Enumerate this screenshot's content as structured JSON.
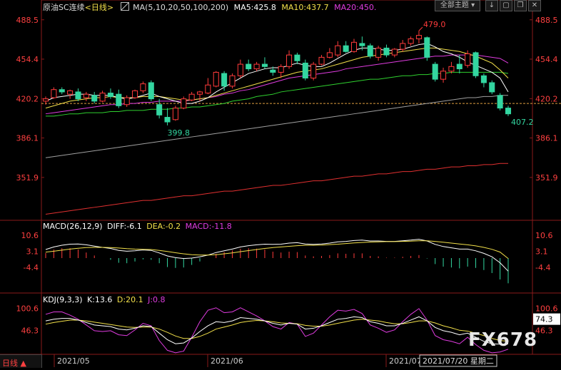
{
  "header": {
    "instrument": "原油SC连续",
    "period": "<日线>",
    "ma_label": "MA(5,10,20,50,100,200)",
    "ma5": "MA5:425.8",
    "ma10": "MA10:437.7",
    "ma20": "MA20:450.",
    "theme_button": "全部主题",
    "icon_names": [
      "chart-type-icon",
      "theme-dropdown-icon",
      "down-arrow-icon",
      "expand-icon",
      "restore-icon",
      "close-icon"
    ]
  },
  "colors": {
    "up": "#ff3b3b",
    "down": "#33d6a0",
    "ma5": "#ffffff",
    "ma10": "#f2e04a",
    "ma20": "#e03ce0",
    "ma50": "#2fd12f",
    "ma100": "#a0a0a0",
    "ma200": "#e03030",
    "price_tick": "#ff4040",
    "macd_title": "#ffffff",
    "dea": "#f2e04a",
    "macd_val": "#e03ce0",
    "k_line": "#ffffff",
    "d_line": "#f2e04a",
    "j_line": "#e03ce0"
  },
  "chart_data": {
    "type": "candlestick",
    "ylim": [
      316,
      497
    ],
    "y_ticks": [
      "488.5",
      "454.4",
      "420.2",
      "386.1",
      "351.9"
    ],
    "x_labels": [
      "2021/05",
      "2021/06",
      "2021/07"
    ],
    "crosshair_label": "2021/07/20 星期二",
    "annotations": {
      "high": "479.0",
      "low_mid": "399.8",
      "last": "407.2"
    },
    "reference_price": 416,
    "candles": [
      {
        "o": 418,
        "h": 422,
        "l": 415,
        "c": 420
      },
      {
        "o": 421,
        "h": 430,
        "l": 420,
        "c": 428
      },
      {
        "o": 428,
        "h": 430,
        "l": 424,
        "c": 426
      },
      {
        "o": 424,
        "h": 428,
        "l": 420,
        "c": 427
      },
      {
        "o": 426,
        "h": 429,
        "l": 418,
        "c": 420
      },
      {
        "o": 421,
        "h": 426,
        "l": 418,
        "c": 424
      },
      {
        "o": 423,
        "h": 426,
        "l": 416,
        "c": 418
      },
      {
        "o": 418,
        "h": 427,
        "l": 417,
        "c": 425
      },
      {
        "o": 425,
        "h": 429,
        "l": 420,
        "c": 422
      },
      {
        "o": 424,
        "h": 428,
        "l": 412,
        "c": 414
      },
      {
        "o": 415,
        "h": 423,
        "l": 413,
        "c": 421
      },
      {
        "o": 421,
        "h": 428,
        "l": 420,
        "c": 427
      },
      {
        "o": 427,
        "h": 435,
        "l": 425,
        "c": 433
      },
      {
        "o": 434,
        "h": 436,
        "l": 418,
        "c": 420
      },
      {
        "o": 415,
        "h": 420,
        "l": 403,
        "c": 406
      },
      {
        "o": 404,
        "h": 412,
        "l": 397,
        "c": 400
      },
      {
        "o": 402,
        "h": 414,
        "l": 401,
        "c": 412
      },
      {
        "o": 412,
        "h": 422,
        "l": 411,
        "c": 420
      },
      {
        "o": 419,
        "h": 426,
        "l": 418,
        "c": 424
      },
      {
        "o": 424,
        "h": 427,
        "l": 418,
        "c": 426
      },
      {
        "o": 425,
        "h": 438,
        "l": 424,
        "c": 432
      },
      {
        "o": 431,
        "h": 444,
        "l": 430,
        "c": 443
      },
      {
        "o": 442,
        "h": 444,
        "l": 427,
        "c": 431
      },
      {
        "o": 431,
        "h": 442,
        "l": 429,
        "c": 440
      },
      {
        "o": 440,
        "h": 454,
        "l": 438,
        "c": 450
      },
      {
        "o": 450,
        "h": 454,
        "l": 444,
        "c": 446
      },
      {
        "o": 446,
        "h": 452,
        "l": 444,
        "c": 450
      },
      {
        "o": 450,
        "h": 456,
        "l": 446,
        "c": 448
      },
      {
        "o": 445,
        "h": 448,
        "l": 440,
        "c": 443
      },
      {
        "o": 443,
        "h": 450,
        "l": 438,
        "c": 448
      },
      {
        "o": 448,
        "h": 462,
        "l": 446,
        "c": 458
      },
      {
        "o": 458,
        "h": 460,
        "l": 450,
        "c": 453
      },
      {
        "o": 451,
        "h": 454,
        "l": 436,
        "c": 438
      },
      {
        "o": 438,
        "h": 452,
        "l": 436,
        "c": 450
      },
      {
        "o": 450,
        "h": 458,
        "l": 449,
        "c": 456
      },
      {
        "o": 456,
        "h": 464,
        "l": 455,
        "c": 460
      },
      {
        "o": 458,
        "h": 470,
        "l": 456,
        "c": 466
      },
      {
        "o": 466,
        "h": 470,
        "l": 460,
        "c": 461
      },
      {
        "o": 461,
        "h": 472,
        "l": 460,
        "c": 469
      },
      {
        "o": 468,
        "h": 474,
        "l": 462,
        "c": 466
      },
      {
        "o": 466,
        "h": 468,
        "l": 455,
        "c": 457
      },
      {
        "o": 456,
        "h": 466,
        "l": 453,
        "c": 464
      },
      {
        "o": 464,
        "h": 467,
        "l": 456,
        "c": 458
      },
      {
        "o": 458,
        "h": 464,
        "l": 456,
        "c": 463
      },
      {
        "o": 463,
        "h": 471,
        "l": 461,
        "c": 468
      },
      {
        "o": 468,
        "h": 474,
        "l": 466,
        "c": 472
      },
      {
        "o": 472,
        "h": 479,
        "l": 468,
        "c": 475
      },
      {
        "o": 473,
        "h": 474,
        "l": 453,
        "c": 456
      },
      {
        "o": 450,
        "h": 452,
        "l": 435,
        "c": 437
      },
      {
        "o": 437,
        "h": 447,
        "l": 434,
        "c": 444
      },
      {
        "o": 444,
        "h": 452,
        "l": 442,
        "c": 448
      },
      {
        "o": 450,
        "h": 458,
        "l": 442,
        "c": 446
      },
      {
        "o": 449,
        "h": 462,
        "l": 447,
        "c": 459
      },
      {
        "o": 460,
        "h": 461,
        "l": 438,
        "c": 440
      },
      {
        "o": 440,
        "h": 442,
        "l": 430,
        "c": 434
      },
      {
        "o": 434,
        "h": 436,
        "l": 424,
        "c": 426
      },
      {
        "o": 423,
        "h": 425,
        "l": 410,
        "c": 412
      },
      {
        "o": 412,
        "h": 414,
        "l": 405,
        "c": 407
      }
    ],
    "ma5": [
      418,
      421,
      422,
      423,
      424,
      424,
      423,
      423,
      423,
      421,
      420,
      421,
      423,
      425,
      422,
      420,
      418,
      416,
      416,
      418,
      421,
      426,
      430,
      434,
      438,
      442,
      444,
      446,
      447,
      447,
      449,
      451,
      449,
      448,
      448,
      451,
      455,
      459,
      462,
      464,
      464,
      463,
      462,
      462,
      463,
      465,
      467,
      468,
      465,
      461,
      459,
      456,
      452,
      449,
      446,
      443,
      438,
      426
    ],
    "ma10": [
      412,
      414,
      416,
      418,
      419,
      420,
      421,
      421,
      422,
      421,
      421,
      421,
      422,
      422,
      422,
      421,
      420,
      419,
      419,
      420,
      421,
      423,
      425,
      427,
      429,
      431,
      433,
      435,
      437,
      439,
      441,
      443,
      444,
      445,
      446,
      448,
      450,
      452,
      454,
      456,
      457,
      458,
      459,
      460,
      461,
      462,
      463,
      464,
      464,
      463,
      462,
      461,
      459,
      457,
      454,
      451,
      445,
      438
    ],
    "ma20": [
      407,
      408,
      409,
      410,
      411,
      412,
      413,
      414,
      415,
      415,
      416,
      416,
      417,
      417,
      418,
      418,
      418,
      418,
      419,
      420,
      421,
      422,
      424,
      425,
      427,
      428,
      430,
      432,
      434,
      436,
      438,
      439,
      440,
      441,
      442,
      443,
      444,
      446,
      447,
      448,
      449,
      450,
      451,
      452,
      453,
      454,
      455,
      456,
      457,
      457,
      458,
      458,
      458,
      458,
      457,
      456,
      455,
      451
    ],
    "ma50": [
      405,
      405,
      406,
      407,
      407,
      408,
      408,
      408,
      409,
      409,
      410,
      410,
      410,
      411,
      411,
      411,
      412,
      412,
      413,
      413,
      414,
      415,
      416,
      418,
      419,
      420,
      422,
      423,
      424,
      426,
      427,
      428,
      429,
      430,
      431,
      432,
      433,
      434,
      435,
      436,
      437,
      437,
      438,
      439,
      440,
      440,
      441,
      441,
      442,
      442,
      443,
      443,
      443,
      443,
      443,
      443,
      443,
      442
    ],
    "ma100": [
      369,
      370,
      371,
      372,
      373,
      374,
      375,
      376,
      377,
      378,
      379,
      380,
      381,
      382,
      383,
      384,
      385,
      386,
      387,
      388,
      389,
      390,
      391,
      392,
      393,
      394,
      395,
      396,
      397,
      398,
      399,
      400,
      401,
      402,
      403,
      404,
      405,
      406,
      407,
      408,
      409,
      410,
      411,
      412,
      413,
      414,
      415,
      416,
      417,
      418,
      419,
      420,
      421,
      421,
      422,
      422,
      423,
      423
    ],
    "ma200": [
      320,
      321,
      322,
      323,
      324,
      325,
      326,
      327,
      328,
      329,
      330,
      331,
      332,
      332,
      333,
      334,
      335,
      336,
      336,
      337,
      338,
      339,
      340,
      340,
      341,
      342,
      343,
      344,
      345,
      345,
      346,
      347,
      348,
      349,
      349,
      350,
      351,
      352,
      353,
      353,
      354,
      355,
      355,
      356,
      357,
      357,
      358,
      359,
      359,
      360,
      361,
      361,
      362,
      362,
      363,
      363,
      364,
      364
    ],
    "macd": {
      "title": "MACD(26,12,9)",
      "diff": "DIFF:-6.1",
      "dea": "DEA:-0.2",
      "macd": "MACD:-11.8",
      "ylim": [
        -16,
        13
      ],
      "y_ticks": [
        "10.6",
        "3.1",
        "-4.4"
      ],
      "diff_values": [
        4.0,
        5.2,
        6.0,
        6.5,
        6.6,
        6.2,
        5.6,
        5.0,
        4.5,
        3.6,
        3.2,
        3.4,
        3.8,
        3.6,
        2.4,
        1.0,
        0.2,
        -0.2,
        0.0,
        0.6,
        1.4,
        2.6,
        3.4,
        4.2,
        5.2,
        5.8,
        6.2,
        6.5,
        6.4,
        6.5,
        7.0,
        7.2,
        6.6,
        6.4,
        6.6,
        7.0,
        7.6,
        7.8,
        8.2,
        8.4,
        8.0,
        8.0,
        7.8,
        7.8,
        8.1,
        8.4,
        8.8,
        8.0,
        6.4,
        5.4,
        4.8,
        4.2,
        4.2,
        3.4,
        2.2,
        0.6,
        -2.2,
        -6.1
      ],
      "dea_values": [
        2.8,
        3.2,
        3.7,
        4.2,
        4.6,
        4.9,
        5.0,
        5.0,
        4.9,
        4.7,
        4.4,
        4.2,
        4.1,
        4.0,
        3.6,
        3.1,
        2.5,
        2.0,
        1.6,
        1.4,
        1.4,
        1.6,
        2.0,
        2.4,
        3.0,
        3.5,
        4.0,
        4.5,
        4.9,
        5.2,
        5.5,
        5.8,
        6.0,
        6.0,
        6.1,
        6.3,
        6.5,
        6.8,
        7.1,
        7.3,
        7.5,
        7.6,
        7.7,
        7.7,
        7.8,
        7.9,
        8.1,
        8.1,
        7.8,
        7.4,
        7.0,
        6.6,
        6.2,
        5.7,
        5.0,
        4.1,
        2.8,
        -0.2
      ],
      "hist_values": [
        2.4,
        4.0,
        4.6,
        4.6,
        4.0,
        2.6,
        1.2,
        0.0,
        -0.8,
        -2.2,
        -2.4,
        -1.6,
        -0.6,
        -0.8,
        -2.4,
        -4.2,
        -4.6,
        -4.4,
        -3.2,
        -1.6,
        0.0,
        2.0,
        2.8,
        3.6,
        4.4,
        4.6,
        4.4,
        4.0,
        3.0,
        2.6,
        3.0,
        2.8,
        1.2,
        0.8,
        1.0,
        1.4,
        2.2,
        2.0,
        2.2,
        2.2,
        1.0,
        0.8,
        0.2,
        0.2,
        0.6,
        1.0,
        1.4,
        -0.2,
        -2.8,
        -4.0,
        -4.4,
        -4.8,
        -4.0,
        -4.6,
        -5.6,
        -7.0,
        -10.0,
        -11.8
      ]
    },
    "kdj": {
      "title": "KDJ(9,3,3)",
      "k": "K:13.6",
      "d": "D:20.1",
      "j": "J:0.8",
      "ylim": [
        -10,
        112
      ],
      "y_ticks": [
        "100.6",
        "46.3"
      ],
      "crosshair_value": "74.3",
      "k_values": [
        70,
        74,
        76,
        76,
        72,
        66,
        60,
        58,
        56,
        50,
        48,
        52,
        58,
        56,
        40,
        24,
        14,
        16,
        28,
        44,
        58,
        68,
        66,
        70,
        78,
        76,
        74,
        70,
        64,
        60,
        64,
        62,
        50,
        52,
        58,
        66,
        74,
        76,
        80,
        78,
        68,
        64,
        58,
        58,
        64,
        72,
        80,
        70,
        54,
        46,
        42,
        36,
        40,
        30,
        20,
        14,
        13,
        13.6
      ],
      "d_values": [
        62,
        66,
        69,
        72,
        72,
        70,
        67,
        64,
        61,
        58,
        55,
        54,
        55,
        55,
        50,
        42,
        33,
        27,
        27,
        32,
        40,
        50,
        55,
        60,
        66,
        69,
        71,
        70,
        68,
        65,
        64,
        63,
        59,
        57,
        57,
        60,
        64,
        68,
        72,
        74,
        72,
        70,
        66,
        63,
        63,
        66,
        70,
        70,
        65,
        58,
        53,
        47,
        45,
        40,
        34,
        27,
        22,
        20.1
      ],
      "j_values": [
        86,
        92,
        92,
        84,
        74,
        60,
        46,
        44,
        46,
        36,
        34,
        48,
        64,
        58,
        22,
        -2,
        -8,
        -4,
        30,
        68,
        96,
        102,
        90,
        92,
        102,
        92,
        82,
        70,
        56,
        50,
        66,
        62,
        32,
        40,
        60,
        80,
        96,
        94,
        98,
        88,
        60,
        52,
        42,
        48,
        68,
        86,
        100,
        72,
        34,
        24,
        20,
        14,
        30,
        12,
        -2,
        -8,
        -6,
        0.8
      ]
    }
  },
  "watermark": "FX678",
  "footer": {
    "period_tab": "日线 ▲"
  }
}
